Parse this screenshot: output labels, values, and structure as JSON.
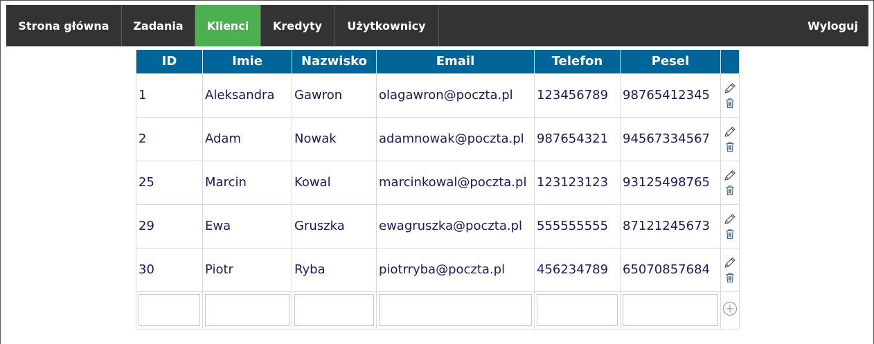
{
  "nav": {
    "items": [
      {
        "label": "Strona główna",
        "active": false
      },
      {
        "label": "Zadania",
        "active": false
      },
      {
        "label": "Klienci",
        "active": true
      },
      {
        "label": "Kredyty",
        "active": false
      },
      {
        "label": "Użytkownicy",
        "active": false
      }
    ],
    "logout_label": "Wyloguj"
  },
  "table": {
    "headers": {
      "id": "ID",
      "imie": "Imie",
      "nazwisko": "Nazwisko",
      "email": "Email",
      "telefon": "Telefon",
      "pesel": "Pesel"
    },
    "rows": [
      {
        "id": "1",
        "imie": "Aleksandra",
        "nazwisko": "Gawron",
        "email": "olagawron@poczta.pl",
        "telefon": "123456789",
        "pesel": "98765412345"
      },
      {
        "id": "2",
        "imie": "Adam",
        "nazwisko": "Nowak",
        "email": "adamnowak@poczta.pl",
        "telefon": "987654321",
        "pesel": "94567334567"
      },
      {
        "id": "25",
        "imie": "Marcin",
        "nazwisko": "Kowal",
        "email": "marcinkowal@poczta.pl",
        "telefon": "123123123",
        "pesel": "93125498765"
      },
      {
        "id": "29",
        "imie": "Ewa",
        "nazwisko": "Gruszka",
        "email": "ewagruszka@poczta.pl",
        "telefon": "555555555",
        "pesel": "87121245673"
      },
      {
        "id": "30",
        "imie": "Piotr",
        "nazwisko": "Ryba",
        "email": "piotrryba@poczta.pl",
        "telefon": "456234789",
        "pesel": "65070857684"
      }
    ],
    "new_row": {
      "id": "",
      "imie": "",
      "nazwisko": "",
      "email": "",
      "telefon": "",
      "pesel": ""
    }
  },
  "icons": {
    "edit": "pencil-icon",
    "delete": "trash-icon",
    "add": "plus-circle-icon"
  },
  "colors": {
    "nav_bg": "#333333",
    "nav_active": "#4caf50",
    "header_bg": "#006699",
    "cell_text": "#1a1a5e"
  }
}
